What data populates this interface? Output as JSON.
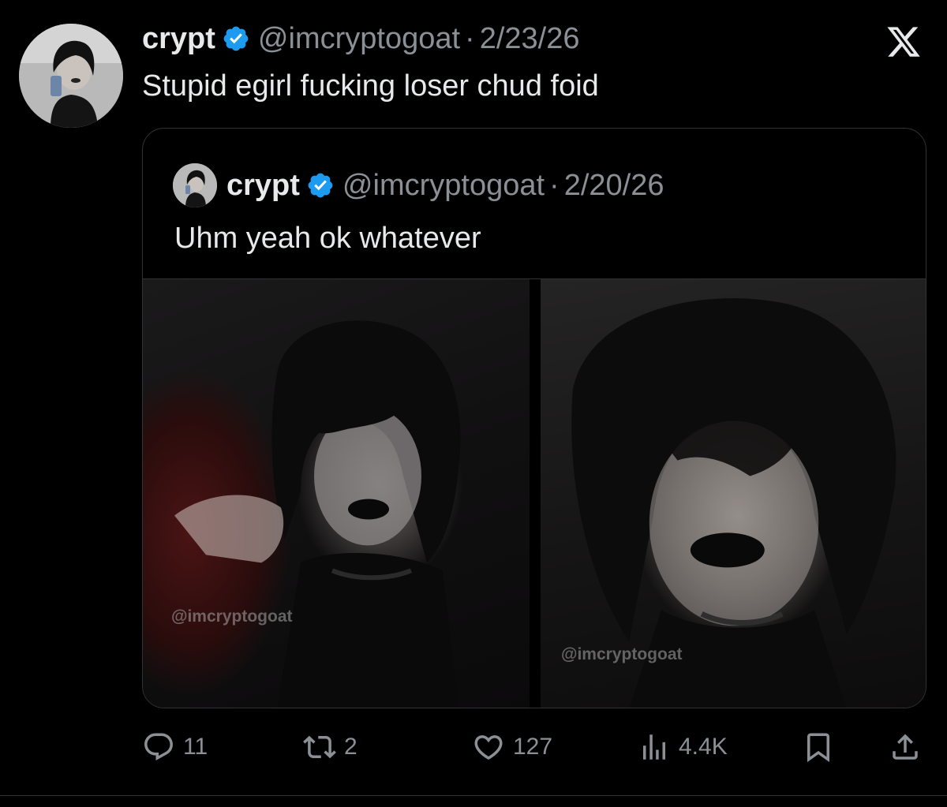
{
  "tweet": {
    "author_name": "crypt",
    "handle": "@imcryptogoat",
    "separator": "·",
    "date": "2/23/26",
    "text": "Stupid egirl fucking loser chud foid",
    "avatar_icon": "profile-avatar",
    "verified_icon": "verified-badge-icon",
    "brand_icon": "x-logo-icon"
  },
  "quoted": {
    "author_name": "crypt",
    "handle": "@imcryptogoat",
    "separator": "·",
    "date": "2/20/26",
    "text": "Uhm yeah ok whatever",
    "photos": [
      {
        "watermark": "@imcryptogoat"
      },
      {
        "watermark": "@imcryptogoat"
      }
    ]
  },
  "actions": {
    "replies": "11",
    "reposts": "2",
    "likes": "127",
    "views": "4.4K",
    "icons": [
      "reply-icon",
      "repost-icon",
      "like-icon",
      "views-icon",
      "bookmark-icon",
      "share-icon"
    ]
  },
  "colors": {
    "background": "#000000",
    "text": "#e7e9ea",
    "muted": "#8b9096",
    "border": "#2f3336",
    "verified": "#1d9bf0"
  }
}
